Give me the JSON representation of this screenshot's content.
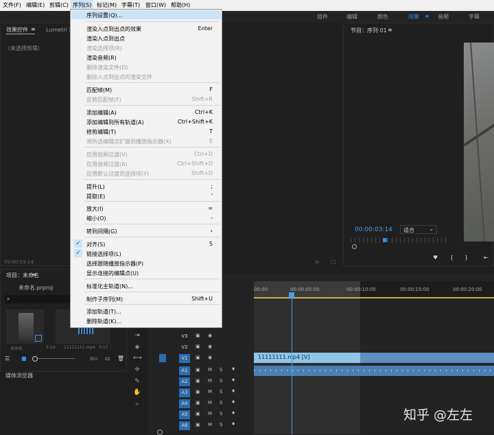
{
  "menubar": {
    "items": [
      "文件(F)",
      "编辑(E)",
      "剪辑(C)",
      "序列(S)",
      "标记(M)",
      "字幕(T)",
      "窗口(W)",
      "帮助(H)"
    ]
  },
  "workspaces": [
    "组件",
    "编辑",
    "颜色",
    "效果",
    "≡",
    "音频",
    "字幕"
  ],
  "left_panel": {
    "tab_active": "效果控件",
    "tab_menu": "≡",
    "tab_other": "Lumetri 范",
    "no_clip": "（未选择剪辑）",
    "timecode": "00:00:03:14"
  },
  "program_monitor": {
    "title": "节目：序列 01",
    "menu": "≡",
    "timecode": "00:00:03:14",
    "fit_label": "适合"
  },
  "project_panel": {
    "title": "项目：未命名",
    "menu": "≡",
    "filename": "未命名.prproj",
    "search_icon": "magnifier-icon",
    "item1_label": "未命名",
    "item1_duration": "3:14",
    "item2_label": "11111111.mp4",
    "item2_duration": "3:17",
    "zoom_label": "Bin",
    "media_browser": "媒体浏览器"
  },
  "sequence_menu": {
    "items": [
      {
        "label": "序列设置(Q)...",
        "key": "",
        "disabled": false,
        "highlight": true
      },
      {
        "label": "渲染入点到出点的效果",
        "key": "Enter",
        "disabled": false
      },
      {
        "label": "渲染入点到出点",
        "key": "",
        "disabled": false
      },
      {
        "label": "渲染选择项(R)",
        "key": "",
        "disabled": true
      },
      {
        "label": "渲染音频(R)",
        "key": "",
        "disabled": false
      },
      {
        "label": "删除渲染文件(D)",
        "key": "",
        "disabled": true
      },
      {
        "label": "删除入点到出点的渲染文件",
        "key": "",
        "disabled": true
      },
      {
        "label": "匹配帧(M)",
        "key": "F",
        "disabled": false
      },
      {
        "label": "反转匹配帧(F)",
        "key": "Shift+R",
        "disabled": true
      },
      {
        "label": "添加编辑(A)",
        "key": "Ctrl+K",
        "disabled": false
      },
      {
        "label": "添加编辑到所有轨道(A)",
        "key": "Ctrl+Shift+K",
        "disabled": false
      },
      {
        "label": "修剪编辑(T)",
        "key": "T",
        "disabled": false
      },
      {
        "label": "将所选编辑点扩展到播放指示器(X)",
        "key": "E",
        "disabled": true
      },
      {
        "label": "应用视频过渡(V)",
        "key": "Ctrl+D",
        "disabled": true
      },
      {
        "label": "应用音频过渡(A)",
        "key": "Ctrl+Shift+D",
        "disabled": true
      },
      {
        "label": "应用默认过渡到选择项(Y)",
        "key": "Shift+D",
        "disabled": true
      },
      {
        "label": "提升(L)",
        "key": ";",
        "disabled": false
      },
      {
        "label": "提取(E)",
        "key": "'",
        "disabled": false
      },
      {
        "label": "放大(I)",
        "key": "=",
        "disabled": false
      },
      {
        "label": "缩小(O)",
        "key": "-",
        "disabled": false
      },
      {
        "label": "转到间隔(G)",
        "key": "›",
        "disabled": false
      },
      {
        "label": "对齐(S)",
        "key": "S",
        "disabled": false,
        "checked": true
      },
      {
        "label": "链接选择项(L)",
        "key": "",
        "disabled": false,
        "checked": true
      },
      {
        "label": "选择跟随播放指示器(P)",
        "key": "",
        "disabled": false
      },
      {
        "label": "显示连接的编辑点(U)",
        "key": "",
        "disabled": false
      },
      {
        "label": "标准化主轨道(N)...",
        "key": "",
        "disabled": false
      },
      {
        "label": "制作子序列(M)",
        "key": "Shift+U",
        "disabled": false
      },
      {
        "label": "添加轨道(T)...",
        "key": "",
        "disabled": false
      },
      {
        "label": "删除轨道(K)...",
        "key": "",
        "disabled": false
      }
    ]
  },
  "timeline": {
    "ruler": [
      "00:00",
      "00:00:05:00",
      "00:00:10:00",
      "00:00:15:00",
      "00:00:20:00"
    ],
    "video_tracks": [
      "V3",
      "V2",
      "V1"
    ],
    "audio_tracks": [
      "A1",
      "A2",
      "A3",
      "A4",
      "A5",
      "A6"
    ],
    "mute": "M",
    "solo": "S",
    "clip_label": "11111111.mp4 [V]"
  },
  "watermark": "知乎 @左左"
}
